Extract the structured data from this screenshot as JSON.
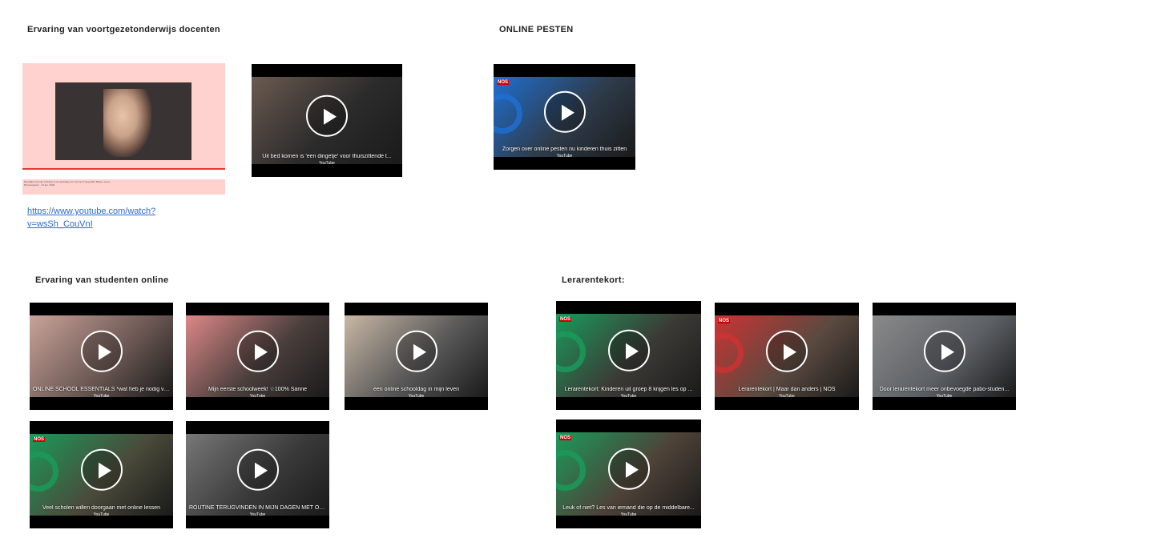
{
  "sections": {
    "teachers": {
      "heading": "Ervaring van voortgezetonderwijs docenten",
      "link": "https://www.youtube.com/watch?v=wsSh_CouVnI"
    },
    "pesten": {
      "heading": "ONLINE PESTEN"
    },
    "students": {
      "heading": "Ervaring van studenten online"
    },
    "shortage": {
      "heading": "Lerarentekort:"
    }
  },
  "screenshot_meta": {
    "line1": "Meebijken bij mijn onlineles & de werkdag van Yvonne ♥ Vlog #46 | Biljoen Loren",
    "line2": "68 weergaven · 13 apr. 2020"
  },
  "videos": [
    {
      "title": "Uit bed komen is 'een dingetje' voor thuiszittende t...",
      "source": "YouTube",
      "scene": "#2b2b2b",
      "accent": "#6b5a50"
    },
    {
      "title": "Zorgen over online pesten nu kinderen thuis zitten",
      "source": "YouTube",
      "scene": "#2e3b4a",
      "accent": "#1f6fd1",
      "nos": "NOS"
    },
    {
      "title": "ONLINE SCHOOL ESSENTIALS *wat heb je nodig vo...",
      "source": "YouTube",
      "scene": "#6e5a55",
      "accent": "#c9a39a"
    },
    {
      "title": "Mijn eerste schoolweek! ☆100% Sanne",
      "source": "YouTube",
      "scene": "#4a3f3c",
      "accent": "#d88"
    },
    {
      "title": "een online schooldag in mijn leven",
      "source": "YouTube",
      "scene": "#585858",
      "accent": "#c9b8a5"
    },
    {
      "title": "Veel scholen willen doorgaan met online lessen",
      "source": "YouTube",
      "scene": "#4a4a3a",
      "accent": "#1a9a5a",
      "nos": "NOS"
    },
    {
      "title": "ROUTINE TERUGVINDEN IN MIJN DAGEN MET ONLI...",
      "source": "YouTube",
      "scene": "#3a3a3a",
      "accent": "#777"
    },
    {
      "title": "Lerarentekort: Kinderen uit groep 8 krijgen les op ...",
      "source": "YouTube",
      "scene": "#3b3a35",
      "accent": "#1a9a5a",
      "nos": "NOS"
    },
    {
      "title": "Lerarentekort | Maar dan anders | NOS",
      "source": "YouTube",
      "scene": "#5a4a40",
      "accent": "#c33",
      "nos": "NOS"
    },
    {
      "title": "Door lerarentekort meer onbevoegde pabo-studen...",
      "source": "YouTube",
      "scene": "#5d6166",
      "accent": "#8a8a8a"
    },
    {
      "title": "Leuk of niet? Les van iemand die op de middelbare...",
      "source": "YouTube",
      "scene": "#4e4238",
      "accent": "#1a9a5a",
      "nos": "NOS"
    }
  ]
}
